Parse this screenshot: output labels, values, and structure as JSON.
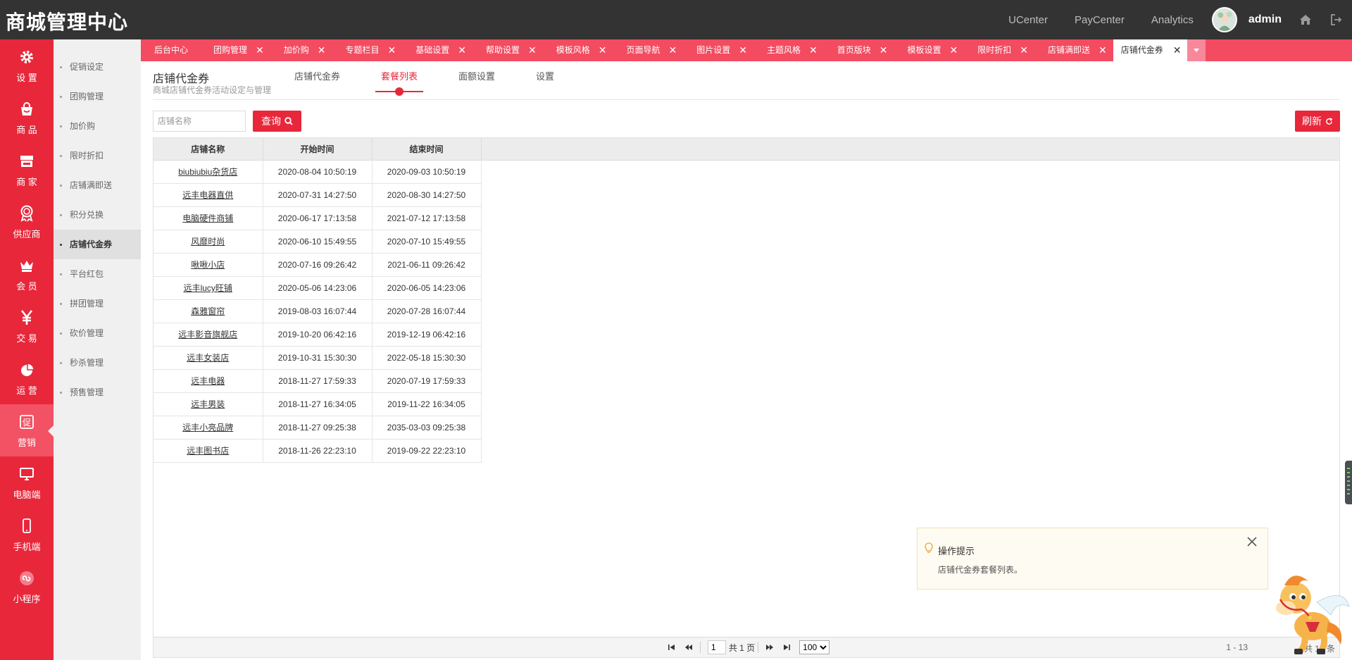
{
  "header": {
    "brand": "商城管理中心",
    "links": [
      "UCenter",
      "PayCenter",
      "Analytics"
    ],
    "user": "admin"
  },
  "mainnav": [
    {
      "label": "设 置",
      "icon": "gear-icon"
    },
    {
      "label": "商 品",
      "icon": "shopping-bag-icon"
    },
    {
      "label": "商 家",
      "icon": "store-icon"
    },
    {
      "label": "供应商",
      "icon": "medal-icon"
    },
    {
      "label": "会 员",
      "icon": "crown-icon"
    },
    {
      "label": "交 易",
      "icon": "yen-icon"
    },
    {
      "label": "运 营",
      "icon": "pie-chart-icon"
    },
    {
      "label": "营销",
      "icon": "promo-icon",
      "active": true
    },
    {
      "label": "电脑端",
      "icon": "monitor-icon"
    },
    {
      "label": "手机端",
      "icon": "mobile-icon"
    },
    {
      "label": "小程序",
      "icon": "mini-program-icon"
    }
  ],
  "subnav": [
    "促销设定",
    "团购管理",
    "加价购",
    "限时折扣",
    "店铺满即送",
    "积分兑换",
    "店铺代金券",
    "平台红包",
    "拼团管理",
    "砍价管理",
    "秒杀管理",
    "预售管理"
  ],
  "subnav_active": "店铺代金券",
  "tabs": [
    "后台中心",
    "团购管理",
    "加价购",
    "专题栏目",
    "基础设置",
    "帮助设置",
    "模板风格",
    "页面导航",
    "图片设置",
    "主题风格",
    "首页版块",
    "模板设置",
    "限时折扣",
    "店铺满即送",
    "店铺代金券"
  ],
  "page": {
    "title": "店铺代金券",
    "subtitle": "商城店铺代金券活动设定与管理",
    "subtabs": [
      "店铺代金券",
      "套餐列表",
      "面额设置",
      "设置"
    ],
    "active_subtab": "套餐列表"
  },
  "toolbar": {
    "search_placeholder": "店铺名称",
    "search_label": "查询",
    "refresh_label": "刷新"
  },
  "table": {
    "columns": [
      "店铺名称",
      "开始时间",
      "结束时间"
    ],
    "rows": [
      [
        "biubiubiu杂货店",
        "2020-08-04 10:50:19",
        "2020-09-03 10:50:19"
      ],
      [
        "远丰电器直供",
        "2020-07-31 14:27:50",
        "2020-08-30 14:27:50"
      ],
      [
        "电脑硬件商铺",
        "2020-06-17 17:13:58",
        "2021-07-12 17:13:58"
      ],
      [
        "风靡时尚",
        "2020-06-10 15:49:55",
        "2020-07-10 15:49:55"
      ],
      [
        "啾啾小店",
        "2020-07-16 09:26:42",
        "2021-06-11 09:26:42"
      ],
      [
        "远丰lucy旺铺",
        "2020-05-06 14:23:06",
        "2020-06-05 14:23:06"
      ],
      [
        "森雅窗帘",
        "2019-08-03 16:07:44",
        "2020-07-28 16:07:44"
      ],
      [
        "远丰影音旗舰店",
        "2019-10-20 06:42:16",
        "2019-12-19 06:42:16"
      ],
      [
        "远丰女装店",
        "2019-10-31 15:30:30",
        "2022-05-18 15:30:30"
      ],
      [
        "远丰电器",
        "2018-11-27 17:59:33",
        "2020-07-19 17:59:33"
      ],
      [
        "远丰男装",
        "2018-11-27 16:34:05",
        "2019-11-22 16:34:05"
      ],
      [
        "远丰小亮品牌",
        "2018-11-27 09:25:38",
        "2035-03-03 09:25:38"
      ],
      [
        "远丰图书店",
        "2018-11-26 22:23:10",
        "2019-09-22 22:23:10"
      ]
    ]
  },
  "pager": {
    "page": "1",
    "total_pages_text": "共 1 页",
    "page_size": "100",
    "range": "1 - 13",
    "total": "共 13 条"
  },
  "tip": {
    "title": "操作提示",
    "text": "店铺代金券套餐列表。"
  },
  "colors": {
    "topbar": "#333333",
    "accent": "#e8273b",
    "tabbar": "#f34b60"
  }
}
